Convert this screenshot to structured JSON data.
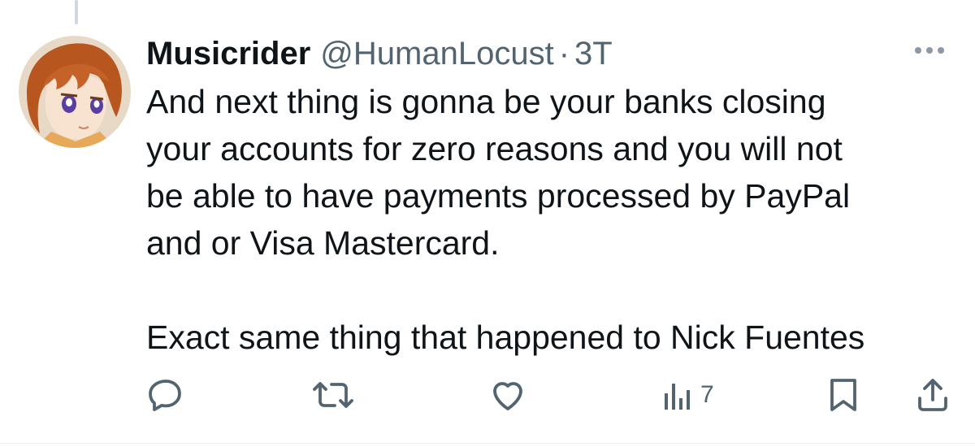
{
  "tweet": {
    "display_name": "Musicrider",
    "handle": "@HumanLocust",
    "separator": "·",
    "time": "3T",
    "lines": [
      "And next thing is gonna be your banks closing",
      "your accounts for zero reasons and you will not",
      "be able to have payments processed by PayPal",
      "and or Visa Mastercard."
    ],
    "last_line": "Exact same thing that happened to Nick Fuentes"
  },
  "actions": {
    "reply_icon": "reply-icon",
    "retweet_icon": "retweet-icon",
    "like_icon": "heart-icon",
    "views_icon": "views-icon",
    "views_count": "7",
    "bookmark_icon": "bookmark-icon",
    "share_icon": "share-icon"
  },
  "colors": {
    "text": "#0f1419",
    "muted": "#536471",
    "divider": "#eff3f4"
  }
}
